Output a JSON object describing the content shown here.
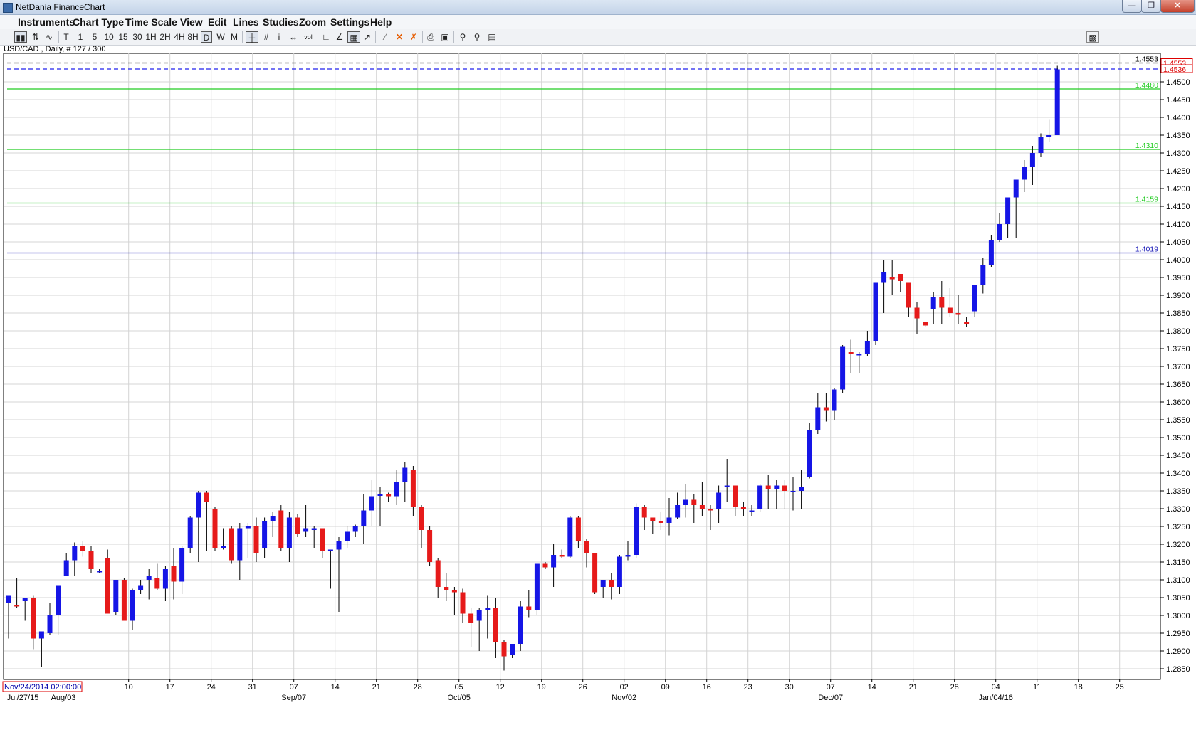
{
  "window": {
    "title": "NetDania FinanceChart",
    "icon": "chart-app-icon",
    "buttons": {
      "minimize": "minimize-icon",
      "maximize": "restore-icon",
      "close": "close-icon"
    }
  },
  "menu": [
    "Instruments",
    "Chart Type",
    "Time Scale",
    "View",
    "Edit",
    "Lines",
    "Studies",
    "Zoom",
    "Settings",
    "Help"
  ],
  "toolbar": {
    "timescales": [
      "T",
      "1",
      "5",
      "10",
      "15",
      "30",
      "1H",
      "2H",
      "4H",
      "8H",
      "D",
      "W",
      "M"
    ],
    "selected_timescale": "D"
  },
  "instrument_label": "USD/CAD , Daily, # 127 / 300",
  "crosshair_date": "Nov/24/2014 02:00:00",
  "colors": {
    "up": "#1515e6",
    "down": "#e61a1a",
    "grid": "#d4d4d4",
    "support_green": "#22cc22",
    "support_blue": "#1a1ab8",
    "dash_black": "#000000",
    "dash_blue": "#2222ee",
    "price_red": "#dd0000"
  },
  "chart_data": {
    "type": "candlestick",
    "instrument": "USD/CAD",
    "timeframe": "Daily",
    "y_ticks": [
      "1.2850",
      "1.2900",
      "1.2950",
      "1.3000",
      "1.3050",
      "1.3100",
      "1.3150",
      "1.3200",
      "1.3250",
      "1.3300",
      "1.3350",
      "1.3400",
      "1.3450",
      "1.3500",
      "1.3550",
      "1.3600",
      "1.3650",
      "1.3700",
      "1.3750",
      "1.3800",
      "1.3850",
      "1.3900",
      "1.3950",
      "1.4000",
      "1.4050",
      "1.4100",
      "1.4150",
      "1.4200",
      "1.4250",
      "1.4300",
      "1.4350",
      "1.4400",
      "1.4450",
      "1.4500"
    ],
    "y_range": [
      1.282,
      1.458
    ],
    "x_ticks": [
      "10",
      "17",
      "24",
      "31",
      "07",
      "14",
      "21",
      "28",
      "05",
      "12",
      "19",
      "26",
      "02",
      "09",
      "16",
      "23",
      "30",
      "07",
      "14",
      "21",
      "28",
      "04",
      "11",
      "18",
      "25"
    ],
    "x_month_labels": [
      "Jul/27/15",
      "Aug/03",
      "Sep/07",
      "Oct/05",
      "Nov/02",
      "Dec/07",
      "Jan/04/16"
    ],
    "horizontal_lines": [
      {
        "value": "1.4553",
        "style": "dash-black"
      },
      {
        "value": "1.4536",
        "style": "dash-blue"
      },
      {
        "value": "1.4480",
        "style": "support-green"
      },
      {
        "value": "1.4310",
        "style": "support-green"
      },
      {
        "value": "1.4159",
        "style": "support-green"
      },
      {
        "value": "1.4019",
        "style": "support-blue"
      }
    ],
    "last_price_labels": [
      "1.4553",
      "1.4536"
    ],
    "candles": [
      [
        1.3035,
        1.3055,
        1.2935,
        1.3055
      ],
      [
        1.303,
        1.3105,
        1.302,
        1.3025
      ],
      [
        1.304,
        1.3045,
        1.2985,
        1.305
      ],
      [
        1.305,
        1.3055,
        1.2905,
        1.2935
      ],
      [
        1.2935,
        1.2955,
        1.2855,
        1.2955
      ],
      [
        1.295,
        1.3035,
        1.2945,
        1.3
      ],
      [
        1.3,
        1.3085,
        1.2945,
        1.3085
      ],
      [
        1.311,
        1.3175,
        1.3125,
        1.3155
      ],
      [
        1.3155,
        1.3205,
        1.311,
        1.3195
      ],
      [
        1.3195,
        1.321,
        1.3165,
        1.318
      ],
      [
        1.318,
        1.3195,
        1.312,
        1.313
      ],
      [
        1.3125,
        1.313,
        1.312,
        1.3125
      ],
      [
        1.316,
        1.3185,
        1.303,
        1.3005
      ],
      [
        1.301,
        1.31,
        1.3,
        1.31
      ],
      [
        1.31,
        1.3105,
        1.3005,
        1.2985
      ],
      [
        1.2985,
        1.3075,
        1.296,
        1.307
      ],
      [
        1.307,
        1.31,
        1.306,
        1.3085
      ],
      [
        1.31,
        1.313,
        1.3045,
        1.311
      ],
      [
        1.3105,
        1.3145,
        1.307,
        1.3075
      ],
      [
        1.3075,
        1.314,
        1.304,
        1.313
      ],
      [
        1.314,
        1.319,
        1.3045,
        1.3095
      ],
      [
        1.3095,
        1.3195,
        1.306,
        1.319
      ],
      [
        1.319,
        1.328,
        1.3175,
        1.3275
      ],
      [
        1.3275,
        1.335,
        1.315,
        1.3345
      ],
      [
        1.3345,
        1.335,
        1.318,
        1.332
      ],
      [
        1.33,
        1.3305,
        1.318,
        1.319
      ],
      [
        1.319,
        1.3245,
        1.3185,
        1.3195
      ],
      [
        1.3245,
        1.325,
        1.3145,
        1.3155
      ],
      [
        1.3155,
        1.326,
        1.31,
        1.3245
      ],
      [
        1.3245,
        1.326,
        1.316,
        1.325
      ],
      [
        1.325,
        1.3275,
        1.315,
        1.3175
      ],
      [
        1.319,
        1.3275,
        1.316,
        1.3265
      ],
      [
        1.3265,
        1.329,
        1.322,
        1.328
      ],
      [
        1.3295,
        1.331,
        1.318,
        1.319
      ],
      [
        1.319,
        1.329,
        1.315,
        1.3275
      ],
      [
        1.3275,
        1.3285,
        1.322,
        1.323
      ],
      [
        1.3235,
        1.331,
        1.322,
        1.3245
      ],
      [
        1.324,
        1.325,
        1.319,
        1.3245
      ],
      [
        1.3245,
        1.3245,
        1.316,
        1.318
      ],
      [
        1.318,
        1.3175,
        1.3075,
        1.3185
      ],
      [
        1.3185,
        1.322,
        1.301,
        1.321
      ],
      [
        1.321,
        1.325,
        1.319,
        1.3235
      ],
      [
        1.3235,
        1.3255,
        1.322,
        1.325
      ],
      [
        1.325,
        1.334,
        1.32,
        1.3295
      ],
      [
        1.3295,
        1.338,
        1.325,
        1.3335
      ],
      [
        1.334,
        1.336,
        1.325,
        1.334
      ],
      [
        1.334,
        1.3345,
        1.332,
        1.3335
      ],
      [
        1.3335,
        1.341,
        1.331,
        1.3375
      ],
      [
        1.3375,
        1.343,
        1.332,
        1.3415
      ],
      [
        1.341,
        1.342,
        1.328,
        1.3305
      ],
      [
        1.3305,
        1.331,
        1.319,
        1.324
      ],
      [
        1.324,
        1.325,
        1.314,
        1.315
      ],
      [
        1.3155,
        1.316,
        1.305,
        1.308
      ],
      [
        1.308,
        1.312,
        1.304,
        1.307
      ],
      [
        1.307,
        1.308,
        1.3,
        1.3065
      ],
      [
        1.3065,
        1.3075,
        1.298,
        1.3005
      ],
      [
        1.3005,
        1.302,
        1.291,
        1.298
      ],
      [
        1.2985,
        1.302,
        1.29,
        1.3015
      ],
      [
        1.302,
        1.3055,
        1.2935,
        1.302
      ],
      [
        1.302,
        1.305,
        1.288,
        1.2925
      ],
      [
        1.2925,
        1.293,
        1.2845,
        1.2885
      ],
      [
        1.289,
        1.291,
        1.288,
        1.292
      ],
      [
        1.292,
        1.304,
        1.29,
        1.3025
      ],
      [
        1.3025,
        1.307,
        1.2995,
        1.3015
      ],
      [
        1.3015,
        1.3065,
        1.3,
        1.3145
      ],
      [
        1.3145,
        1.315,
        1.313,
        1.3135
      ],
      [
        1.3135,
        1.32,
        1.308,
        1.317
      ],
      [
        1.317,
        1.3185,
        1.316,
        1.3165
      ],
      [
        1.3165,
        1.328,
        1.316,
        1.3275
      ],
      [
        1.3275,
        1.328,
        1.319,
        1.321
      ],
      [
        1.321,
        1.3215,
        1.3135,
        1.3175
      ],
      [
        1.3175,
        1.317,
        1.306,
        1.3065
      ],
      [
        1.308,
        1.31,
        1.305,
        1.31
      ],
      [
        1.31,
        1.312,
        1.3045,
        1.308
      ],
      [
        1.308,
        1.317,
        1.306,
        1.3165
      ],
      [
        1.3165,
        1.321,
        1.3155,
        1.317
      ],
      [
        1.317,
        1.3315,
        1.316,
        1.3305
      ],
      [
        1.3305,
        1.331,
        1.324,
        1.3275
      ],
      [
        1.3275,
        1.3275,
        1.323,
        1.3265
      ],
      [
        1.3265,
        1.329,
        1.324,
        1.326
      ],
      [
        1.326,
        1.333,
        1.3225,
        1.3275
      ],
      [
        1.3275,
        1.3345,
        1.327,
        1.331
      ],
      [
        1.331,
        1.337,
        1.3275,
        1.3325
      ],
      [
        1.3325,
        1.334,
        1.326,
        1.331
      ],
      [
        1.331,
        1.3375,
        1.328,
        1.33
      ],
      [
        1.33,
        1.331,
        1.324,
        1.3295
      ],
      [
        1.33,
        1.3365,
        1.326,
        1.3345
      ],
      [
        1.336,
        1.344,
        1.332,
        1.3365
      ],
      [
        1.3365,
        1.3345,
        1.328,
        1.3305
      ],
      [
        1.3305,
        1.332,
        1.328,
        1.33
      ],
      [
        1.3295,
        1.331,
        1.328,
        1.3295
      ],
      [
        1.33,
        1.337,
        1.329,
        1.3365
      ],
      [
        1.3365,
        1.3395,
        1.33,
        1.3355
      ],
      [
        1.3355,
        1.338,
        1.33,
        1.3365
      ],
      [
        1.3365,
        1.338,
        1.33,
        1.335
      ],
      [
        1.335,
        1.339,
        1.3295,
        1.335
      ],
      [
        1.335,
        1.341,
        1.33,
        1.336
      ],
      [
        1.339,
        1.354,
        1.3385,
        1.352
      ],
      [
        1.352,
        1.3625,
        1.351,
        1.3585
      ],
      [
        1.3585,
        1.3625,
        1.3545,
        1.3575
      ],
      [
        1.3575,
        1.364,
        1.355,
        1.3635
      ],
      [
        1.3635,
        1.376,
        1.3625,
        1.3755
      ],
      [
        1.374,
        1.3775,
        1.368,
        1.3735
      ],
      [
        1.3735,
        1.374,
        1.368,
        1.3735
      ],
      [
        1.3735,
        1.38,
        1.373,
        1.377
      ],
      [
        1.377,
        1.386,
        1.376,
        1.3935
      ],
      [
        1.3935,
        1.4,
        1.385,
        1.3965
      ],
      [
        1.395,
        1.4,
        1.39,
        1.3945
      ],
      [
        1.396,
        1.396,
        1.391,
        1.394
      ],
      [
        1.3935,
        1.393,
        1.384,
        1.3865
      ],
      [
        1.3865,
        1.388,
        1.379,
        1.3835
      ],
      [
        1.3825,
        1.3825,
        1.381,
        1.3815
      ],
      [
        1.386,
        1.391,
        1.382,
        1.3895
      ],
      [
        1.3895,
        1.394,
        1.382,
        1.3865
      ],
      [
        1.3865,
        1.392,
        1.384,
        1.385
      ],
      [
        1.385,
        1.39,
        1.382,
        1.3845
      ],
      [
        1.3825,
        1.384,
        1.381,
        1.382
      ],
      [
        1.3855,
        1.392,
        1.384,
        1.393
      ],
      [
        1.393,
        1.4005,
        1.3905,
        1.3985
      ],
      [
        1.3985,
        1.407,
        1.398,
        1.4055
      ],
      [
        1.4055,
        1.413,
        1.405,
        1.41
      ],
      [
        1.41,
        1.416,
        1.406,
        1.4175
      ],
      [
        1.4175,
        1.42,
        1.406,
        1.4225
      ],
      [
        1.4225,
        1.428,
        1.419,
        1.426
      ],
      [
        1.426,
        1.432,
        1.421,
        1.43
      ],
      [
        1.43,
        1.4355,
        1.429,
        1.4345
      ],
      [
        1.4345,
        1.4395,
        1.433,
        1.435
      ],
      [
        1.435,
        1.4545,
        1.435,
        1.4535
      ]
    ]
  }
}
